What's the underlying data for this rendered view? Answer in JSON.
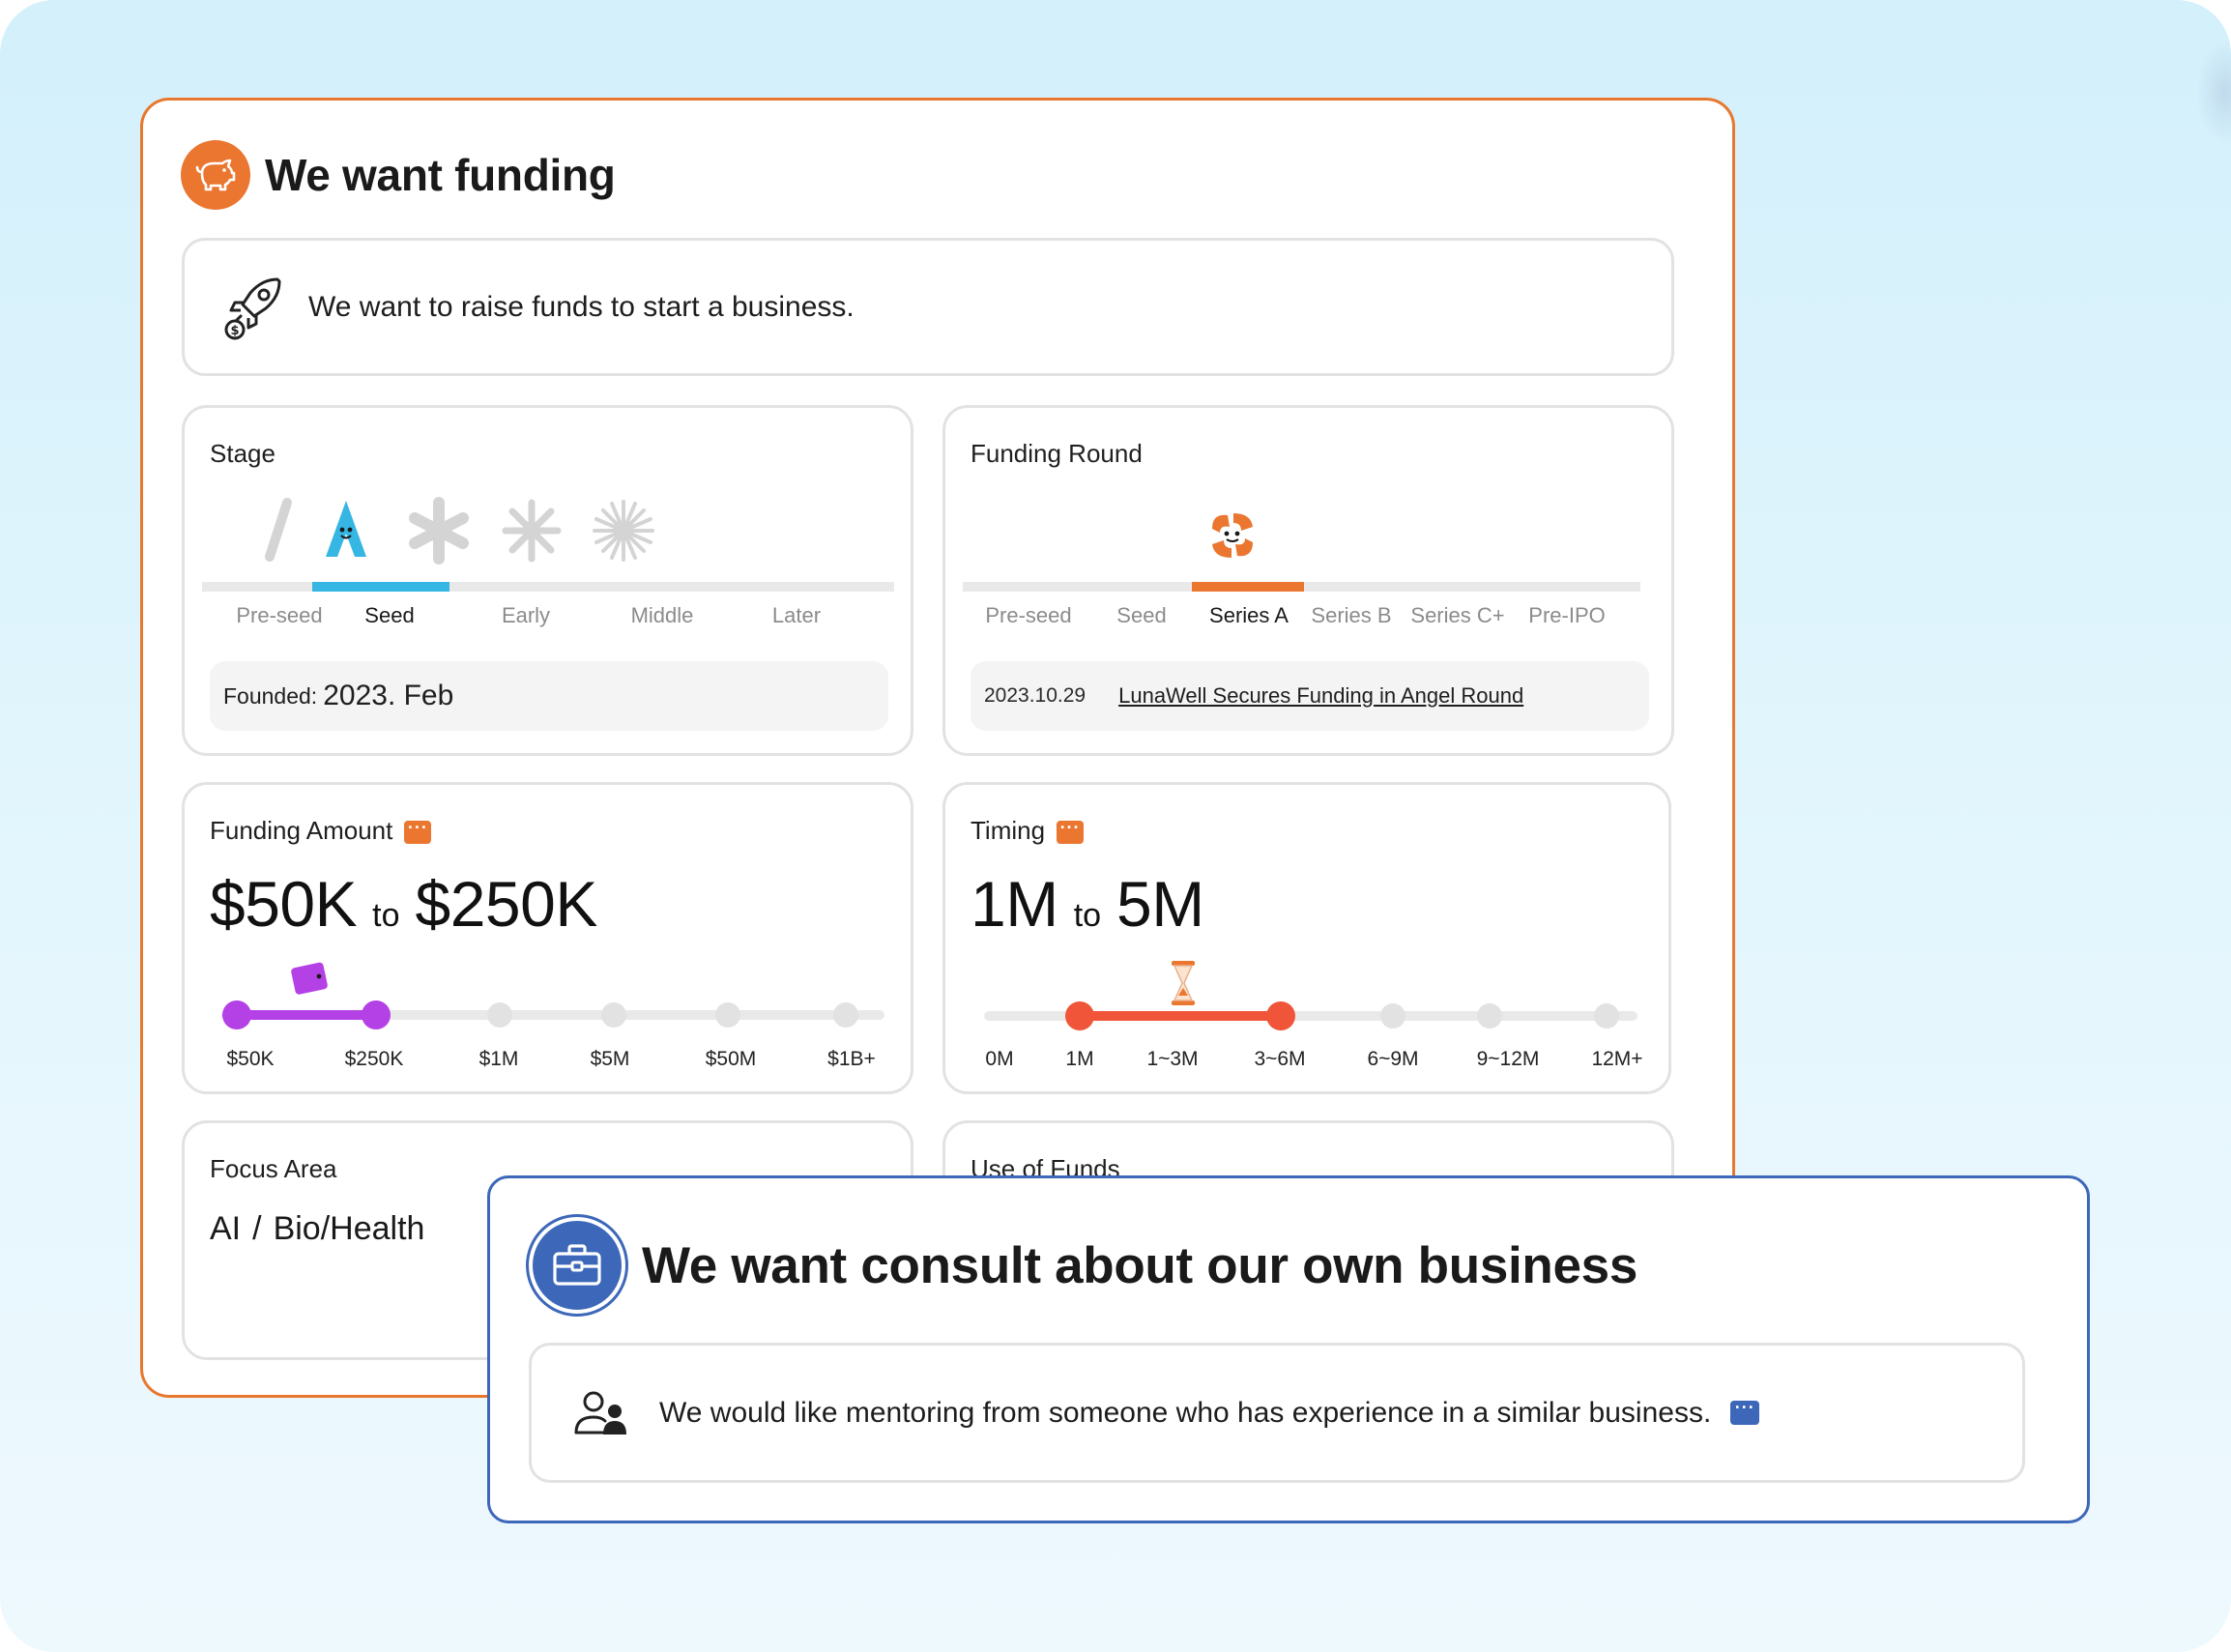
{
  "funding": {
    "title": "We want funding",
    "icon": "piggy-bank-icon",
    "accent": "#ea7630",
    "statement": "We want to raise funds to start a business.",
    "stage": {
      "label": "Stage",
      "options": [
        "Pre-seed",
        "Seed",
        "Early",
        "Middle",
        "Later"
      ],
      "selected": "Seed",
      "active_color": "#36b6e3",
      "founded_prefix": "Founded:",
      "founded_value": "2023. Feb"
    },
    "funding_round": {
      "label": "Funding Round",
      "options": [
        "Pre-seed",
        "Seed",
        "Series A",
        "Series B",
        "Series C+",
        "Pre-IPO"
      ],
      "selected": "Series A",
      "news_date": "2023.10.29",
      "news_title": "LunaWell Secures Funding in Angel Round"
    },
    "funding_amount": {
      "label": "Funding Amount",
      "from": "$50K",
      "to_word": "to",
      "to": "$250K",
      "ticks": [
        "$50K",
        "$250K",
        "$1M",
        "$5M",
        "$50M",
        "$1B+"
      ],
      "range_color": "#b441e6"
    },
    "timing": {
      "label": "Timing",
      "from": "1M",
      "to_word": "to",
      "to": "5M",
      "ticks": [
        "0M",
        "1M",
        "1~3M",
        "3~6M",
        "6~9M",
        "9~12M",
        "12M+"
      ],
      "range_color": "#f0553a"
    },
    "focus_area": {
      "label": "Focus Area",
      "items": [
        "AI",
        "Bio/Health"
      ],
      "separator": "/"
    },
    "use_of_funds": {
      "label": "Use of Funds"
    }
  },
  "consult": {
    "title": "We want consult about our own business",
    "icon": "briefcase-icon",
    "accent": "#3d67b9",
    "statement": "We would like mentoring from someone who has experience in a similar business."
  }
}
